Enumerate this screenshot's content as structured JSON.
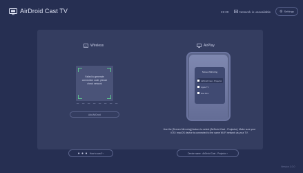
{
  "header": {
    "app_title": "AirDroid Cast TV",
    "clock": "21:20",
    "network_label": "Network is unavailable",
    "settings_label": "Settings"
  },
  "wireless": {
    "title": "Wireless",
    "qr_message": "Failed to generate connection code, please check network",
    "code_placeholder": "_ _ _ _  _ _ _ _",
    "switch_button": "Add AirDroid",
    "help_dots": "● ● ●",
    "help_label": "How to cast? ›"
  },
  "airplay": {
    "title": "AirPlay",
    "phone_menu_title": "Screen Mirroring",
    "phone_menu_items": [
      "AirDroid Cast - Projector",
      "Apple TV",
      "Mac Mini"
    ],
    "description": "Use the [Screen Mirroring] feature to select [AirDroid Cast - Projector]. Make sure your iOS / macOS device is connected to the same Wi-Fi network as your TV.",
    "device_name_label": "Device name : AirDroid Cast - Projector ›"
  },
  "footer": {
    "version": "Version 1.0.0"
  },
  "colors": {
    "background": "#262f52",
    "panel": "#343d60",
    "accent_green": "#5cc58e"
  },
  "icons": [
    "cast-logo-icon",
    "wifi-icon",
    "gear-icon",
    "wireless-icon",
    "airplay-icon"
  ]
}
